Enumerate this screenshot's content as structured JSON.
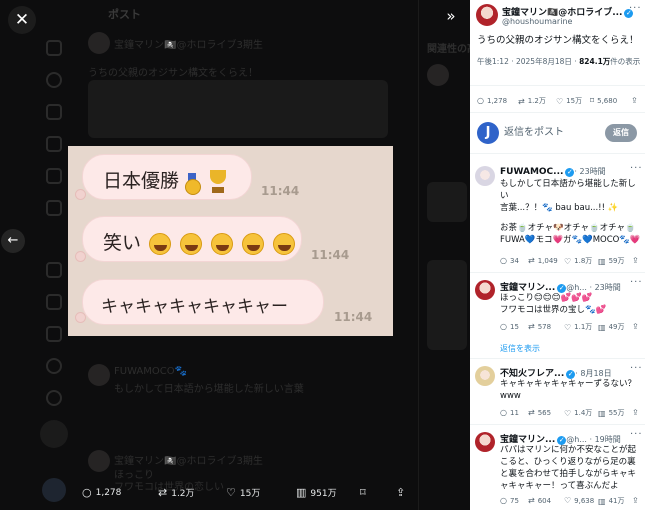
{
  "backdrop": {
    "header_title": "ポスト",
    "author_line": "宝鐘マリン🏴‍☠️@ホロライブ3期生",
    "body_line": "うちの父親のオジサン構文をくらえ！",
    "right_heading": "関連性の高い",
    "reply_author": "FUWAMOCO🐾",
    "reply_text": "もしかして日本語から堪能した新しい言葉",
    "reply2_author": "宝鐘マリン🏴‍☠️@ホロライブ3期生",
    "reply2_line1": "ほっこり",
    "reply2_line2": "フワモコは世界の恋しい"
  },
  "controls": {
    "close": "✕",
    "prev": "←",
    "expand": "»"
  },
  "image": {
    "bubble1_text": "日本優勝",
    "bubble1_time": "11:44",
    "bubble2_text": "笑い",
    "bubble2_time": "11:44",
    "bubble3_text": "キャキャキャキャキャー",
    "bubble3_time": "11:44"
  },
  "media_actions": {
    "replies": "1,278",
    "reposts": "1.2万",
    "likes": "15万",
    "views": "951万"
  },
  "post": {
    "author_name": "宝鐘マリン🏴‍☠️@ホロライブ...",
    "author_handle": "@houshoumarine",
    "text": "うちの父親のオジサン構文をくらえ！",
    "timestamp": "午後1:12 · 2025年8月18日 ·",
    "views_count": "824.1万",
    "views_label": "件の表示",
    "replies": "1,278",
    "reposts": "1.2万",
    "likes": "15万",
    "bookmarks": "5,680"
  },
  "reply_box": {
    "placeholder": "返信をポスト",
    "button": "返信"
  },
  "replies": [
    {
      "name": "FUWAMOC...",
      "meta": "· 23時間",
      "lines": [
        "もしかして日本語から堪能した新しい",
        "言葉...？！🐾 bau bau...!! ✨",
        "",
        "お茶🍵オチャ🐶オチャ🍵オチャ🍵",
        "FUWA💙モコ💗ガ🐾💙MOCO🐾💗"
      ],
      "stats": {
        "replies": "34",
        "reposts": "1,049",
        "likes": "1.8万",
        "views": "59万"
      }
    },
    {
      "name": "宝鐘マリン...",
      "meta": "@h... · 23時間",
      "lines": [
        "ほっこり😊😊😊💕💕💕",
        "フワモコは世界の宝し🐾💕"
      ],
      "stats": {
        "replies": "15",
        "reposts": "578",
        "likes": "1.1万",
        "views": "49万"
      }
    },
    {
      "show_replies": "返信を表示"
    },
    {
      "name": "不知火フレア...",
      "meta": "· 8月18日",
      "lines": [
        "キャキャキャキャキャーずるない？",
        "www"
      ],
      "stats": {
        "replies": "11",
        "reposts": "565",
        "likes": "1.4万",
        "views": "55万"
      }
    },
    {
      "name": "宝鐘マリン...",
      "meta": "@h... · 19時間",
      "lines": [
        "パパはマリンに何か不安なことが起",
        "こると、ひっくり返りながら足の裏",
        "と裏を合わせて拍手しながらキャキ",
        "ャキャキャー！って喜ぶんだよ"
      ],
      "stats": {
        "replies": "75",
        "reposts": "604",
        "likes": "9,638",
        "views": "41万"
      }
    }
  ]
}
